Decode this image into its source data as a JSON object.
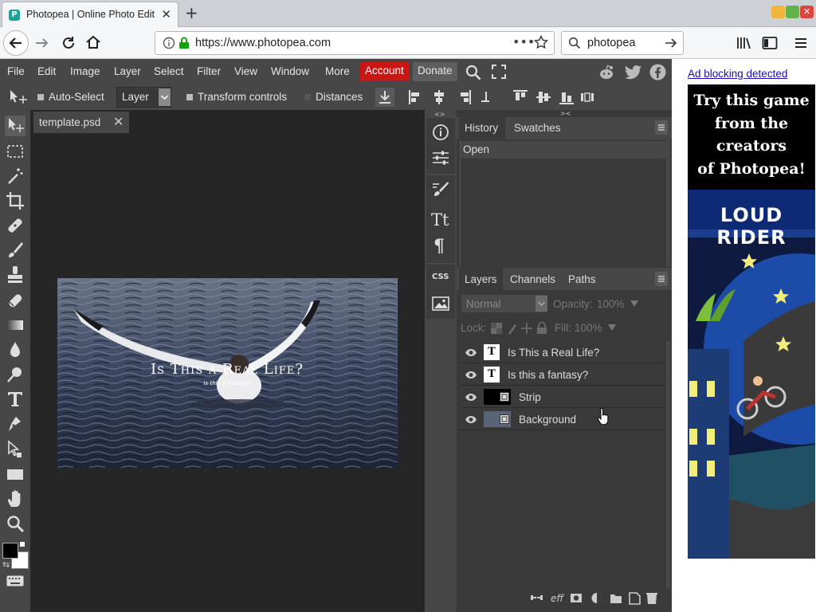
{
  "browser": {
    "tab_title": "Photopea | Online Photo Edit",
    "tab_favicon": "P",
    "url": "https://www.photopea.com",
    "search_text": "photopea"
  },
  "menu": {
    "items": [
      "File",
      "Edit",
      "Image",
      "Layer",
      "Select",
      "Filter",
      "View",
      "Window",
      "More"
    ],
    "account": "Account",
    "donate": "Donate"
  },
  "options": {
    "auto_select": "Auto-Select",
    "layer_select": "Layer",
    "transform_controls": "Transform controls",
    "distances": "Distances"
  },
  "document": {
    "tab_name": "template.psd",
    "title_text": "Is This a Real Life?",
    "subtitle_text": "is this a fantasy?"
  },
  "history_panel": {
    "tabs": [
      "History",
      "Swatches"
    ],
    "entries": [
      "Open"
    ]
  },
  "layers_panel": {
    "tabs": [
      "Layers",
      "Channels",
      "Paths"
    ],
    "blend_mode": "Normal",
    "opacity_label": "Opacity:",
    "opacity_value": "100%",
    "lock_label": "Lock:",
    "fill_label": "Fill:",
    "fill_value": "100%",
    "layers": [
      "Is This a Real Life?",
      "Is this a fantasy?",
      "Strip",
      "Background"
    ]
  },
  "ad": {
    "blocking_text": "Ad blocking detected",
    "headline": [
      "Try this game",
      "from the",
      "creators",
      "of Photopea!"
    ],
    "game_title": "LOUD RIDER"
  },
  "colors": {
    "app_bg": "#474747",
    "canvas_bg": "#262626",
    "account_red": "#cc1515",
    "link_blue": "#1a0dab"
  }
}
